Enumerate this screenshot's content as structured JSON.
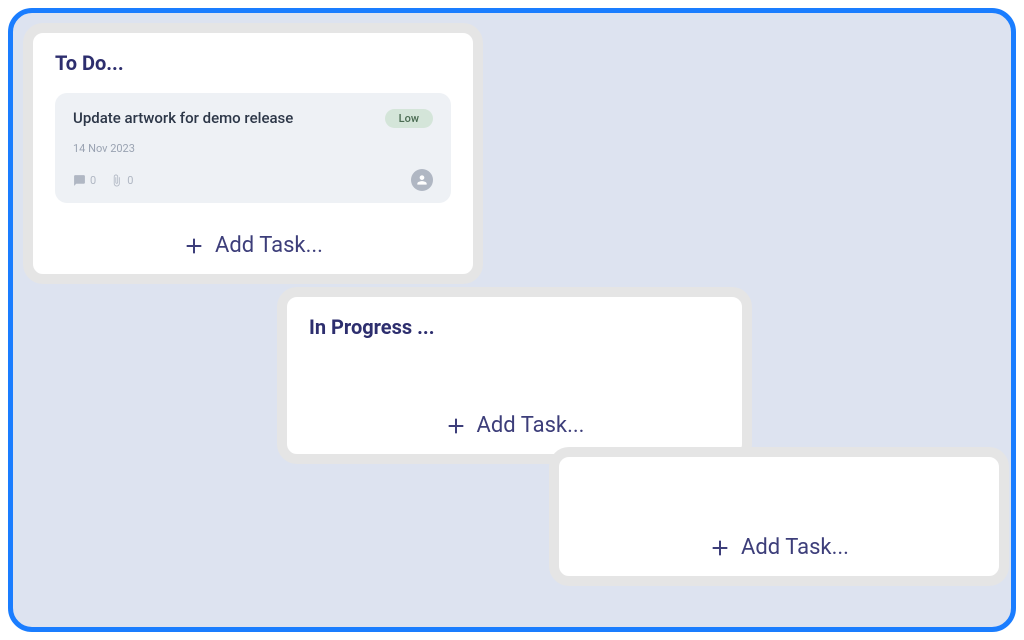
{
  "columns": {
    "todo": {
      "title": "To Do...",
      "add_label": "Add Task...",
      "cards": [
        {
          "title": "Update artwork for demo release",
          "priority": "Low",
          "date": "14 Nov 2023",
          "comments": "0",
          "attachments": "0"
        }
      ]
    },
    "in_progress": {
      "title": "In Progress ...",
      "add_label": "Add Task..."
    },
    "third": {
      "title": "",
      "add_label": "Add Task..."
    }
  }
}
